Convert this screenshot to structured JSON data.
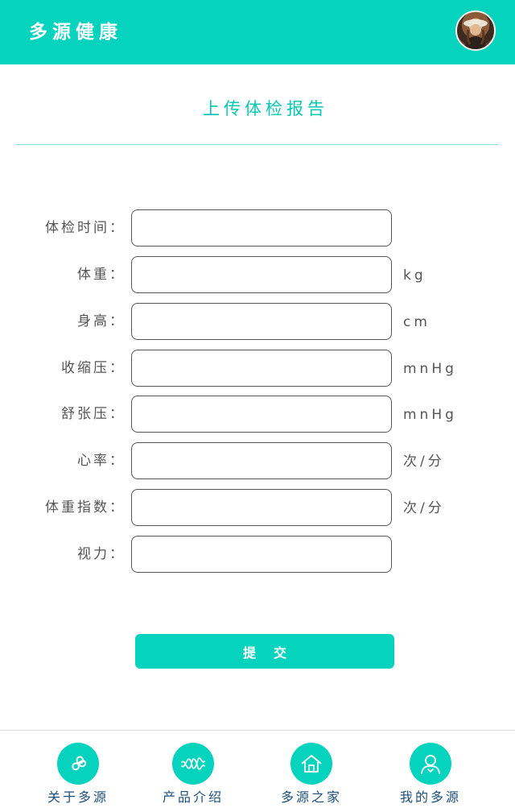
{
  "header": {
    "title": "多源健康",
    "avatar": "user-avatar"
  },
  "page": {
    "title": "上传体检报告"
  },
  "form": {
    "fields": [
      {
        "label": "体检时间：",
        "value": "",
        "unit": ""
      },
      {
        "label": "体重：",
        "value": "",
        "unit": "kg"
      },
      {
        "label": "身高：",
        "value": "",
        "unit": "cm"
      },
      {
        "label": "收缩压：",
        "value": "",
        "unit": "mnHg"
      },
      {
        "label": "舒张压：",
        "value": "",
        "unit": "mnHg"
      },
      {
        "label": "心率：",
        "value": "",
        "unit": "次/分"
      },
      {
        "label": "体重指数：",
        "value": "",
        "unit": "次/分"
      },
      {
        "label": "视力：",
        "value": "",
        "unit": ""
      }
    ],
    "submit_label": "提交"
  },
  "tabbar": {
    "items": [
      {
        "label": "关于多源",
        "icon": "brand-swirl-icon"
      },
      {
        "label": "产品介绍",
        "icon": "dna-wave-icon"
      },
      {
        "label": "多源之家",
        "icon": "home-icon"
      },
      {
        "label": "我的多源",
        "icon": "user-icon"
      }
    ]
  },
  "colors": {
    "accent": "#06d3bd",
    "tab_label": "#1d4f7a",
    "text": "#555555"
  }
}
